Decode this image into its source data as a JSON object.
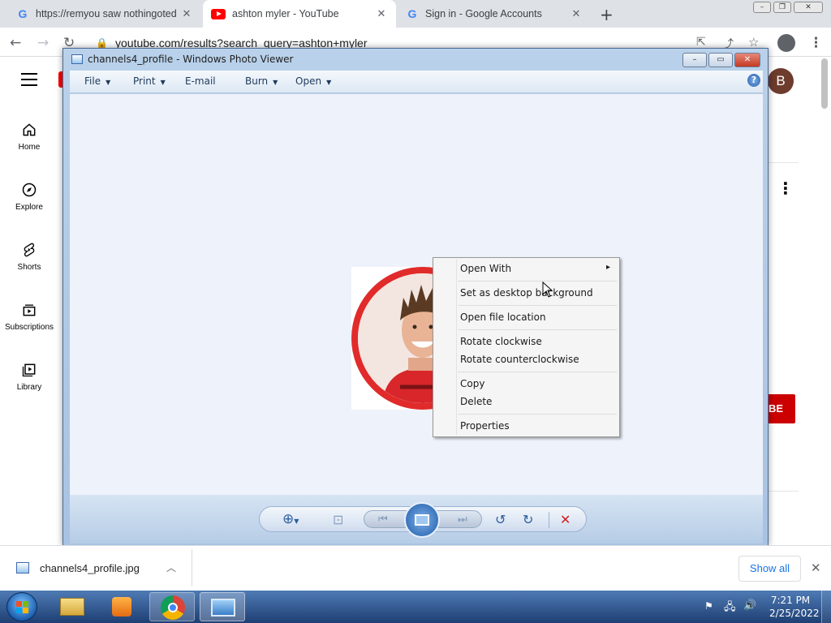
{
  "browser": {
    "tabs": [
      {
        "title": "https://remyou saw nothingoted",
        "favicon": "google-g-icon",
        "active": false
      },
      {
        "title": "ashton myler - YouTube",
        "favicon": "youtube-icon",
        "active": true
      },
      {
        "title": "Sign in - Google Accounts",
        "favicon": "google-g-icon",
        "active": false
      }
    ],
    "new_tab": "+",
    "url": "youtube.com/results?search_query=ashton+myler"
  },
  "youtube": {
    "sidebar": [
      {
        "label": "Home",
        "icon": "home-icon"
      },
      {
        "label": "Explore",
        "icon": "compass-icon"
      },
      {
        "label": "Shorts",
        "icon": "shorts-icon"
      },
      {
        "label": "Subscriptions",
        "icon": "subscriptions-icon"
      },
      {
        "label": "Library",
        "icon": "library-icon"
      }
    ],
    "avatar_letter": "B",
    "subscribe_fragment": "BE"
  },
  "photo_viewer": {
    "title": "channels4_profile - Windows Photo Viewer",
    "menu": [
      "File",
      "Print",
      "E-mail",
      "Burn",
      "Open"
    ],
    "help": "?",
    "caption_buttons": [
      "–",
      "▭",
      "✕"
    ]
  },
  "context_menu": {
    "items": [
      "Open With",
      "Set as desktop background",
      "Open file location",
      "Rotate clockwise",
      "Rotate counterclockwise",
      "Copy",
      "Delete",
      "Properties"
    ],
    "submenu_arrow": "▸"
  },
  "download_bar": {
    "file_name": "channels4_profile.jpg",
    "show_all": "Show all",
    "close": "✕"
  },
  "taskbar": {
    "time": "7:21 PM",
    "date": "2/25/2022"
  },
  "colors": {
    "youtube_red": "#ff0000",
    "subscribe_red": "#cc0000",
    "avatar_brown": "#6d3c2d",
    "taskbar_blue": "#1e3f73"
  }
}
